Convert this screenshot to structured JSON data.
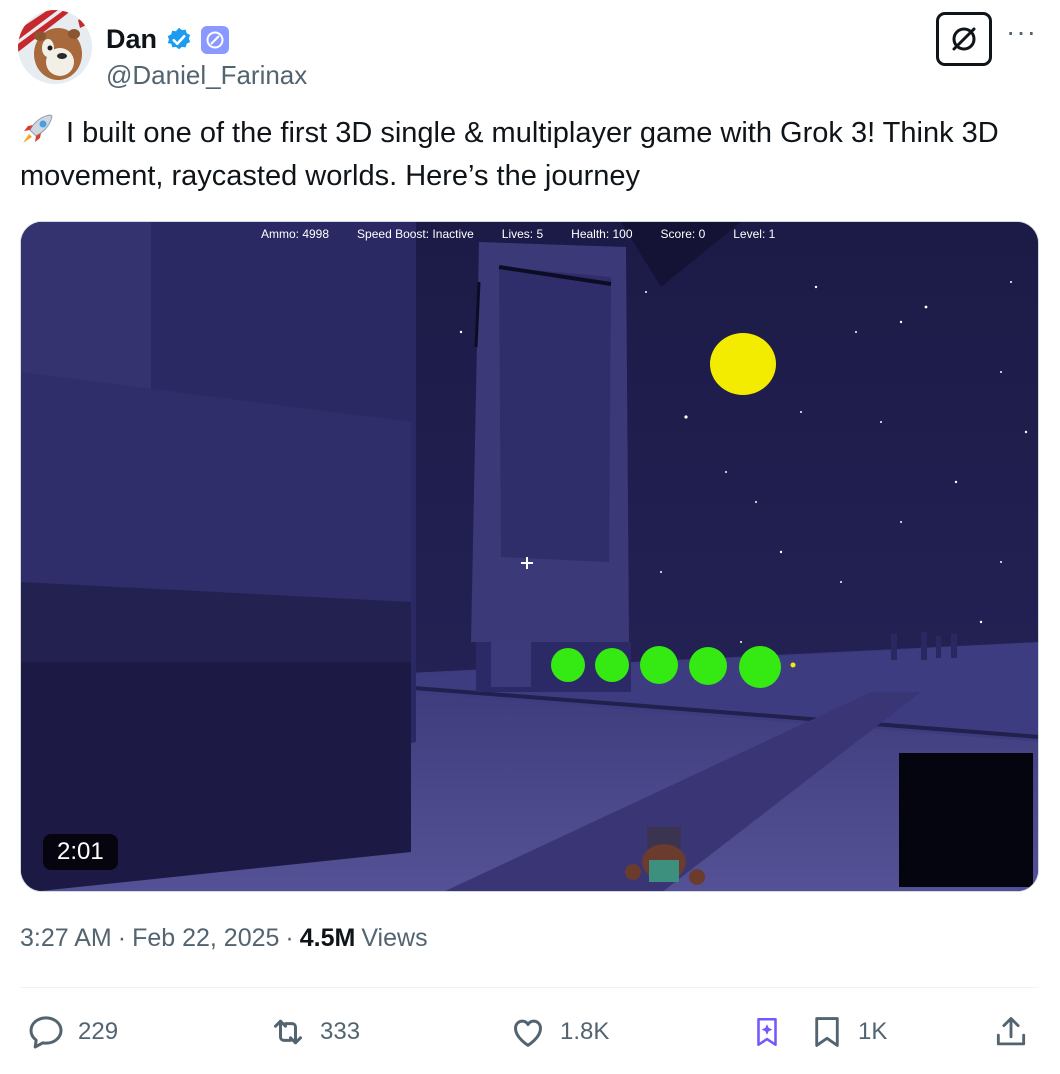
{
  "author": {
    "display_name": "Dan",
    "handle": "@Daniel_Farinax"
  },
  "tweet": {
    "text": "I built one of the first 3D single & multiplayer game with Grok 3! Think 3D movement, raycasted worlds. Here’s the journey",
    "leading_emoji_icon": "rocket-icon"
  },
  "media": {
    "hud": {
      "ammo": "Ammo: 4998",
      "speed_boost": "Speed Boost: Inactive",
      "lives": "Lives: 5",
      "health": "Health: 100",
      "score": "Score: 0",
      "level": "Level: 1"
    },
    "duration": "2:01"
  },
  "meta": {
    "time": "3:27 AM",
    "date": "Feb 22, 2025",
    "views_count": "4.5M",
    "views_label": "Views"
  },
  "actions": {
    "replies": "229",
    "reposts": "333",
    "likes": "1.8K",
    "bookmarks": "1K"
  },
  "colors": {
    "verified_blue": "#1d9bf0",
    "affiliate_purple": "#8b98ff",
    "text_secondary": "#536471",
    "night_sky": "#1f1c4a",
    "moon_yellow": "#f4ec00",
    "enemy_green": "#35ea12"
  }
}
